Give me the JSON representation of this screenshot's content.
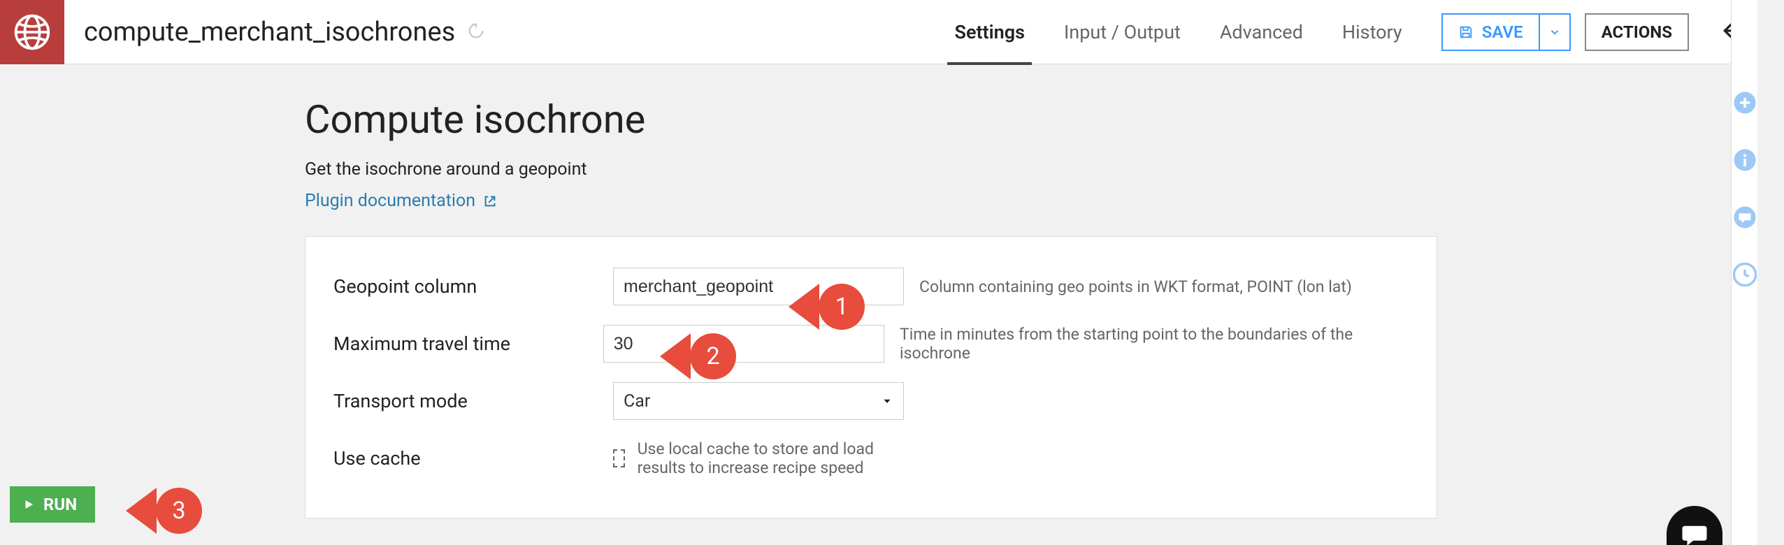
{
  "header": {
    "recipe_name": "compute_merchant_isochrones",
    "tabs": {
      "settings": "Settings",
      "io": "Input / Output",
      "advanced": "Advanced",
      "history": "History"
    },
    "save_label": "SAVE",
    "actions_label": "ACTIONS"
  },
  "page": {
    "title": "Compute isochrone",
    "subtitle": "Get the isochrone around a geopoint",
    "doc_link": "Plugin documentation"
  },
  "form": {
    "geopoint": {
      "label": "Geopoint column",
      "value": "merchant_geopoint",
      "help": "Column containing geo points in WKT format, POINT (lon lat)"
    },
    "max_time": {
      "label": "Maximum travel time",
      "value": "30",
      "help": "Time in minutes from the starting point to the boundaries of the isochrone"
    },
    "mode": {
      "label": "Transport mode",
      "value": "Car"
    },
    "cache": {
      "label": "Use cache",
      "help": "Use local cache to store and load results to increase recipe speed"
    }
  },
  "run_label": "RUN",
  "annotations": {
    "a1": "1",
    "a2": "2",
    "a3": "3"
  }
}
